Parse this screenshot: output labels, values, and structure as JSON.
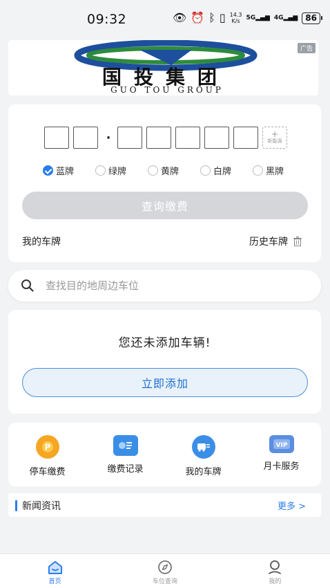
{
  "status": {
    "time": "09:32",
    "speed_top": "14.3",
    "speed_bottom": "K/s",
    "sig1": "5G",
    "sig2": "4G",
    "battery": "86"
  },
  "ad": {
    "tag": "广告",
    "brand_cn": "国投集团",
    "brand_en": "GUO TOU GROUP"
  },
  "plate": {
    "dot": "·",
    "new_energy_plus": "+",
    "new_energy_label": "新能源",
    "colors": [
      "蓝牌",
      "绿牌",
      "黄牌",
      "白牌",
      "黑牌"
    ],
    "selected_color": "蓝牌",
    "query_button": "查询缴费",
    "my_plates": "我的车牌",
    "history_plates": "历史车牌"
  },
  "search": {
    "placeholder": "查找目的地周边车位"
  },
  "vehicle": {
    "empty_text": "您还未添加车辆!",
    "add_button": "立即添加"
  },
  "services": [
    {
      "label": "停车缴费",
      "icon": "parking-coin-icon",
      "color": "#f5a623"
    },
    {
      "label": "缴费记录",
      "icon": "payment-record-icon",
      "color": "#3a8ee6"
    },
    {
      "label": "我的车牌",
      "icon": "my-car-icon",
      "color": "#3a8ee6"
    },
    {
      "label": "月卡服务",
      "icon": "monthly-card-icon",
      "color": "#5b8de0"
    }
  ],
  "news": {
    "title": "新闻资讯",
    "more": "更多 >"
  },
  "tabs": [
    {
      "label": "首页",
      "icon": "home-icon",
      "active": true
    },
    {
      "label": "车位查询",
      "icon": "compass-icon",
      "active": false
    },
    {
      "label": "我的",
      "icon": "profile-icon",
      "active": false
    }
  ],
  "colors": {
    "accent": "#2b7de9",
    "disabled_button": "#d4d6d9",
    "background": "#f2f3f5"
  }
}
